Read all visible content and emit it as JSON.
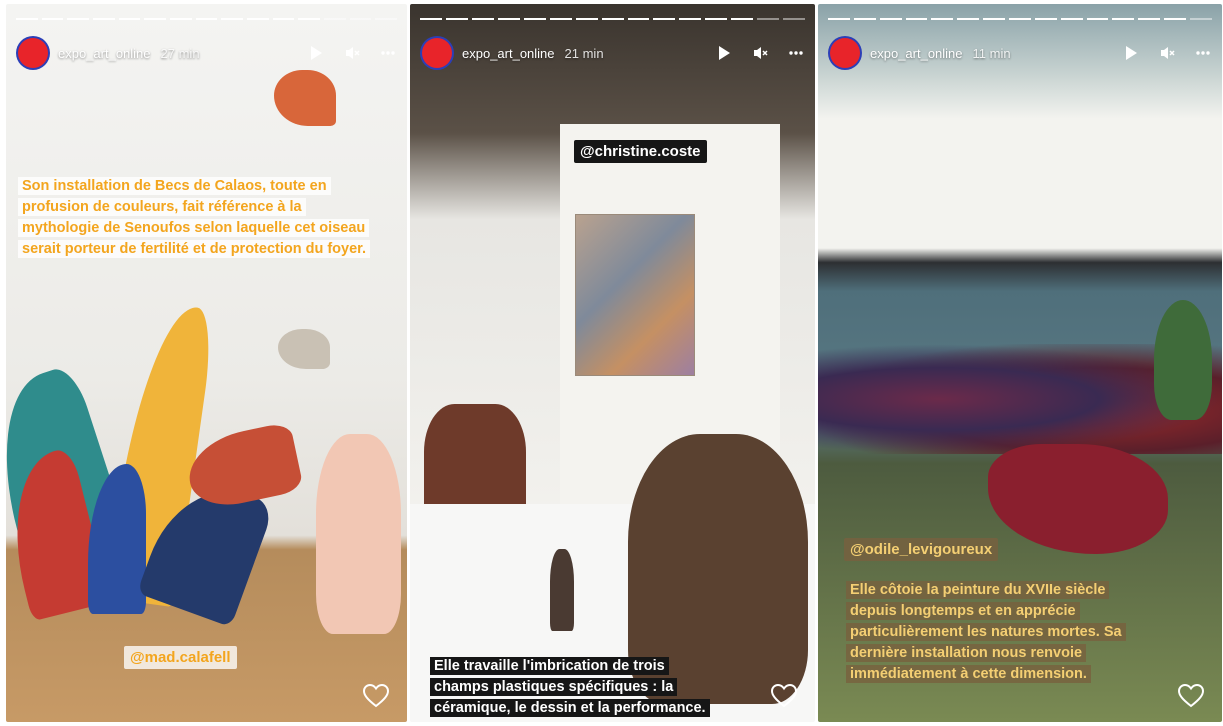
{
  "stories": [
    {
      "username": "expo_art_online",
      "time": "27 min",
      "caption": [
        "Son installation de Becs de Calaos, toute en",
        "profusion de couleurs, fait référence à la",
        "mythologie de Senoufos selon laquelle cet oiseau",
        "serait porteur de fertilité et de protection du foyer."
      ],
      "mention": "@mad.calafell"
    },
    {
      "username": "expo_art_online",
      "time": "21 min",
      "mention": "@christine.coste",
      "caption": [
        "Elle travaille l'imbrication de trois",
        "champs plastiques spécifiques : la",
        "céramique, le dessin et la performance."
      ]
    },
    {
      "username": "expo_art_online",
      "time": "11 min",
      "mention": "@odile_levigoureux",
      "caption": [
        "Elle côtoie la peinture du XVIIe siècle",
        "depuis longtemps et en apprécie",
        "particulièrement les natures mortes. Sa",
        "dernière installation nous renvoie",
        "immédiatement à cette dimension."
      ]
    }
  ],
  "icons": {
    "play": "play-icon",
    "mute": "mute-icon",
    "more": "more-icon",
    "like": "heart-icon"
  },
  "colors": {
    "avatar": "#e8242a",
    "caption_yellow": "#f3a51e"
  }
}
